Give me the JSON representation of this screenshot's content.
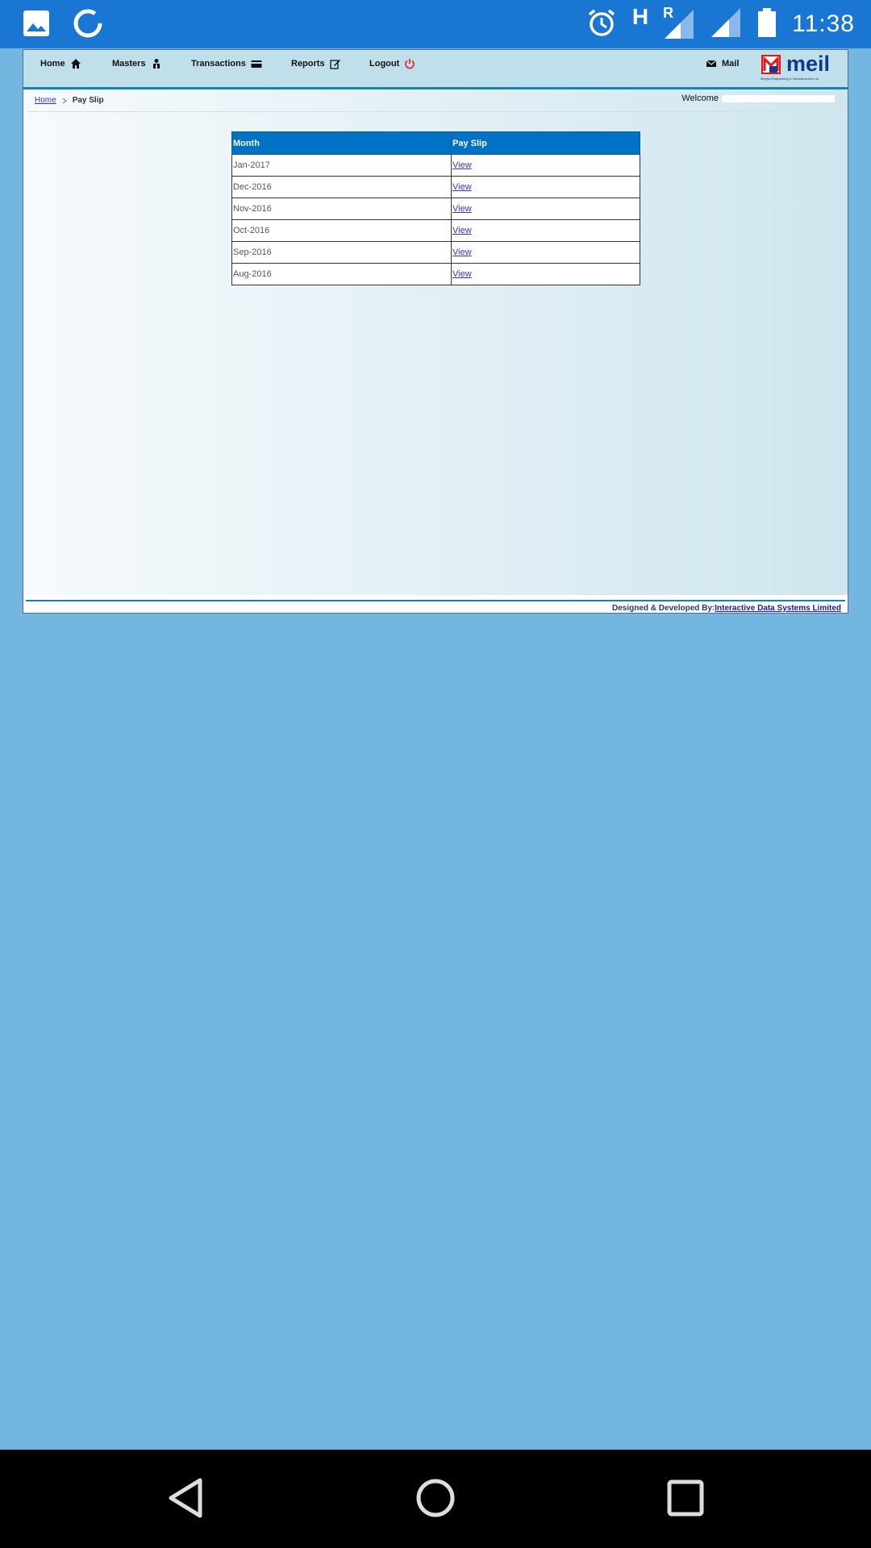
{
  "status_bar": {
    "time": "11:38",
    "network_letter": "H",
    "roaming_letter": "R"
  },
  "nav": {
    "home": "Home",
    "masters": "Masters",
    "transactions": "Transactions",
    "reports": "Reports",
    "logout": "Logout",
    "mail": "Mail"
  },
  "logo": {
    "text": "meil",
    "tagline": "Megha Engineering & Infrastructures Ltd"
  },
  "breadcrumb": {
    "home": "Home",
    "current": "Pay Slip"
  },
  "welcome_label": "Welcome",
  "table": {
    "headers": [
      "Month",
      "Pay Slip"
    ],
    "rows": [
      {
        "month": "Jan-2017",
        "link": "View"
      },
      {
        "month": "Dec-2016",
        "link": "View"
      },
      {
        "month": "Nov-2016",
        "link": "View"
      },
      {
        "month": "Oct-2016",
        "link": "View"
      },
      {
        "month": "Sep-2016",
        "link": "View"
      },
      {
        "month": "Aug-2016",
        "link": "View"
      }
    ]
  },
  "footer": {
    "prefix": "Designed & Developed By:",
    "company": "Interactive Data Systems Limited"
  },
  "colors": {
    "status_bar": "#1976d2",
    "page_bg": "#73b6e0",
    "table_header": "#0072c6",
    "logout_icon": "#d32f2f"
  }
}
